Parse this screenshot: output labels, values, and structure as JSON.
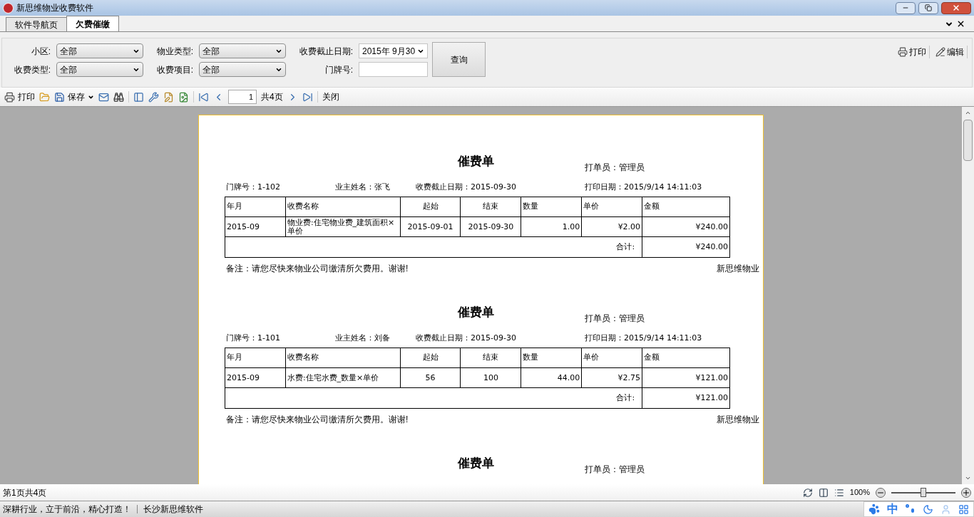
{
  "window": {
    "title": "新思维物业收费软件"
  },
  "tabs": [
    {
      "label": "软件导航页",
      "selected": false
    },
    {
      "label": "欠费催缴",
      "selected": true
    }
  ],
  "filters": [
    {
      "label": "小区:",
      "kind": "select",
      "value": "全部"
    },
    {
      "label": "物业类型:",
      "kind": "select",
      "value": "全部"
    },
    {
      "label": "收费截止日期:",
      "kind": "date",
      "value": "2015年 9月30"
    },
    {
      "label": "收费类型:",
      "kind": "select",
      "value": "全部"
    },
    {
      "label": "收费项目:",
      "kind": "select",
      "value": "全部"
    },
    {
      "label": "门牌号:",
      "kind": "text"
    }
  ],
  "query_button": "查询",
  "top_actions": [
    {
      "label": "打印",
      "kind": "print"
    },
    {
      "label": "编辑",
      "kind": "edit"
    }
  ],
  "toolbar": {
    "print": "打印",
    "save": "保存",
    "page": "1",
    "page_total": "共4页",
    "close": "关闭"
  },
  "report": {
    "notices": [
      {
        "title": "催费单",
        "operator": "打单员：管理员",
        "door": "门牌号：1-102",
        "owner": "业主姓名：张飞",
        "deadline": "收费截止日期：2015-09-30",
        "print_date": "打印日期：2015/9/14 14:11:03",
        "columns": [
          "年月",
          "收费名称",
          "起始",
          "结束",
          "数量",
          "单价",
          "金额"
        ],
        "rows": [
          [
            "2015-09",
            "物业费:住宅物业费_建筑面积×单价",
            "2015-09-01",
            "2015-09-30",
            "1.00",
            "¥2.00",
            "¥240.00"
          ]
        ],
        "total_label": "合计:",
        "total": "¥240.00",
        "remark": "备注：请您尽快来物业公司缴清所欠费用。谢谢!",
        "company": "新思维物业"
      },
      {
        "title": "催费单",
        "operator": "打单员：管理员",
        "door": "门牌号：1-101",
        "owner": "业主姓名：刘备",
        "deadline": "收费截止日期：2015-09-30",
        "print_date": "打印日期：2015/9/14 14:11:03",
        "columns": [
          "年月",
          "收费名称",
          "起始",
          "结束",
          "数量",
          "单价",
          "金额"
        ],
        "rows": [
          [
            "2015-09",
            "水费:住宅水费_数量×单价",
            "56",
            "100",
            "44.00",
            "¥2.75",
            "¥121.00"
          ]
        ],
        "total_label": "合计:",
        "total": "¥121.00",
        "remark": "备注：请您尽快来物业公司缴清所欠费用。谢谢!",
        "company": "新思维物业"
      },
      {
        "title": "催费单",
        "operator": "打单员：管理员"
      }
    ]
  },
  "report_status": {
    "page_info": "第1页共4页",
    "zoom": "100%",
    "zoom_slider": {
      "level": 0.5
    }
  },
  "status_bar": {
    "slogan": "深耕行业，立于前沿，精心打造！",
    "company": "长沙新思维软件",
    "ime": "中"
  }
}
